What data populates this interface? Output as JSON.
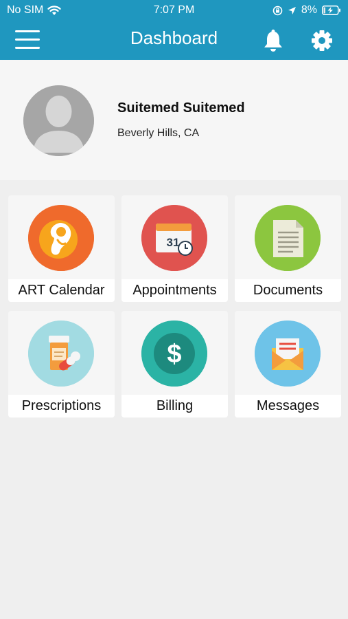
{
  "status_bar": {
    "carrier": "No SIM",
    "time": "7:07 PM",
    "battery": "8%"
  },
  "navbar": {
    "title": "Dashboard"
  },
  "profile": {
    "name": "Suitemed Suitemed",
    "location": "Beverly Hills, CA"
  },
  "tiles": [
    {
      "label": "ART Calendar",
      "icon": "embryo-icon",
      "color": "#ef6a2c"
    },
    {
      "label": "Appointments",
      "icon": "calendar-icon",
      "color": "#e0534f",
      "calendar_day": "31"
    },
    {
      "label": "Documents",
      "icon": "document-icon",
      "color": "#8cc63f"
    },
    {
      "label": "Prescriptions",
      "icon": "pill-bottle-icon",
      "color": "#a2dbe2"
    },
    {
      "label": "Billing",
      "icon": "dollar-icon",
      "color": "#2bb3a5",
      "symbol": "$"
    },
    {
      "label": "Messages",
      "icon": "envelope-icon",
      "color": "#6ec3e8"
    }
  ]
}
